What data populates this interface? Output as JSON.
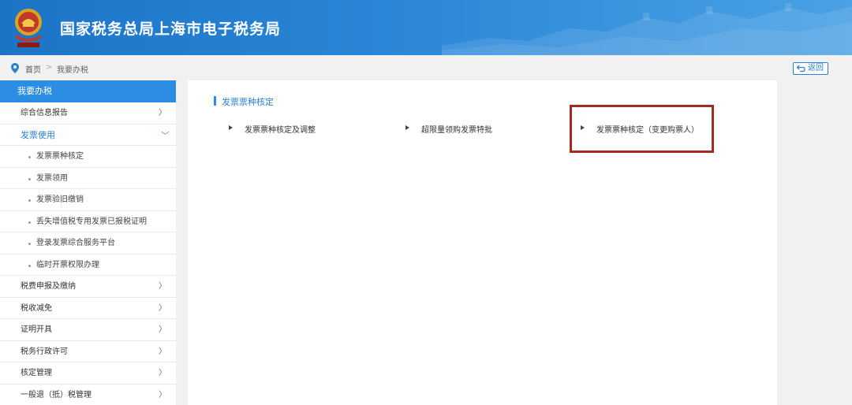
{
  "header": {
    "title": "国家税务总局上海市电子税务局",
    "emblem_icon": "tax-emblem-icon",
    "gradient_start": "#1d74c6",
    "gradient_end": "#4aa1e4"
  },
  "breadcrumb": {
    "home": "首页",
    "separator": ">",
    "current": "我要办税"
  },
  "back_button": {
    "label": "返回"
  },
  "sidebar": {
    "heading": "我要办税",
    "items_before": [
      {
        "label": "综合信息报告",
        "chevron": "〉"
      }
    ],
    "active": {
      "label": "发票使用",
      "chevron": "〉"
    },
    "sub_items": [
      {
        "label": "发票票种核定"
      },
      {
        "label": "发票领用"
      },
      {
        "label": "发票验旧缴销"
      },
      {
        "label": "丢失增值税专用发票已报税证明"
      },
      {
        "label": "登录发票综合服务平台"
      },
      {
        "label": "临时开票权限办理"
      }
    ],
    "items_after": [
      {
        "label": "税费申报及缴纳",
        "chevron": "〉"
      },
      {
        "label": "税收减免",
        "chevron": "〉"
      },
      {
        "label": "证明开具",
        "chevron": "〉"
      },
      {
        "label": "税务行政许可",
        "chevron": "〉"
      },
      {
        "label": "核定管理",
        "chevron": "〉"
      },
      {
        "label": "一般退（抵）税管理",
        "chevron": "〉"
      }
    ]
  },
  "main": {
    "section_title": "发票票种核定",
    "links": [
      {
        "label": "发票票种核定及调整"
      },
      {
        "label": "超限量领购发票特批"
      },
      {
        "label": "发票票种核定（变更购票人）"
      }
    ]
  },
  "colors": {
    "accent": "#2b8ee3",
    "highlight_border": "#a52a20"
  }
}
